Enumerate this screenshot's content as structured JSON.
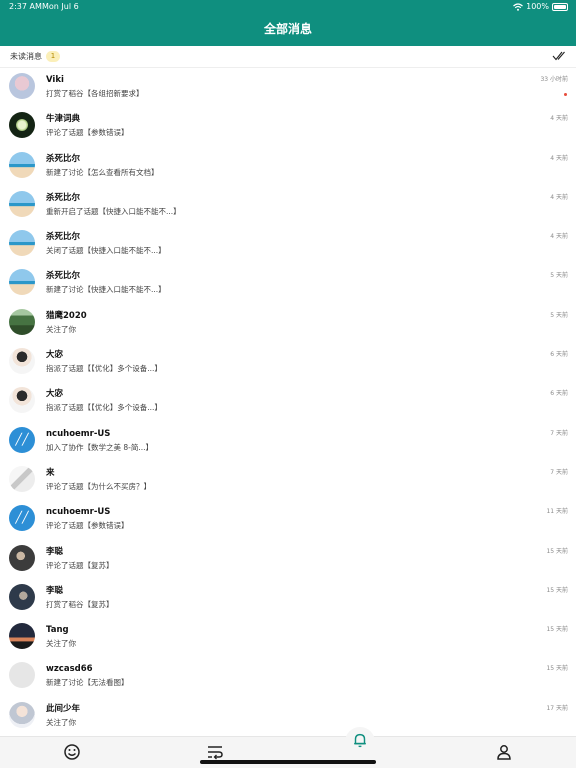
{
  "status_bar": {
    "time": "2:37 AM",
    "date": "Mon Jul 6",
    "battery": "100%"
  },
  "header": {
    "title": "全部消息"
  },
  "filter": {
    "label": "未读消息",
    "unread_count": "1"
  },
  "notifications": [
    {
      "name": "Viki",
      "action": "打赏了稻谷【各组招新要求】",
      "time": "33 小时前",
      "avatar": "av-anime",
      "unread": true
    },
    {
      "name": "牛津词典",
      "action": "评论了话题【参数错误】",
      "time": "4 天前",
      "avatar": "av-flower",
      "unread": false
    },
    {
      "name": "杀死比尔",
      "action": "新建了讨论【怎么查看所有文档】",
      "time": "4 天前",
      "avatar": "av-beach",
      "unread": false
    },
    {
      "name": "杀死比尔",
      "action": "重新开启了话题【快捷入口能不能不...】",
      "time": "4 天前",
      "avatar": "av-beach",
      "unread": false
    },
    {
      "name": "杀死比尔",
      "action": "关闭了话题【快捷入口能不能不...】",
      "time": "4 天前",
      "avatar": "av-beach",
      "unread": false
    },
    {
      "name": "杀死比尔",
      "action": "新建了讨论【快捷入口能不能不...】",
      "time": "5 天前",
      "avatar": "av-beach",
      "unread": false
    },
    {
      "name": "猎鹰2020",
      "action": "关注了你",
      "time": "5 天前",
      "avatar": "av-forest",
      "unread": false
    },
    {
      "name": "大宓",
      "action": "指派了话题【【优化】多个设备...】",
      "time": "6 天前",
      "avatar": "av-person",
      "unread": false
    },
    {
      "name": "大宓",
      "action": "指派了话题【【优化】多个设备...】",
      "time": "6 天前",
      "avatar": "av-person",
      "unread": false
    },
    {
      "name": "ncuhoemr-US",
      "action": "加入了协作【数学之美 8-简...】",
      "time": "7 天前",
      "avatar": "av-logo",
      "unread": false
    },
    {
      "name": "来",
      "action": "评论了话题【为什么不买房？】",
      "time": "7 天前",
      "avatar": "av-silhouette",
      "unread": false
    },
    {
      "name": "ncuhoemr-US",
      "action": "评论了话题【参数错误】",
      "time": "11 天前",
      "avatar": "av-logo",
      "unread": false
    },
    {
      "name": "李聪",
      "action": "评论了话题【复苏】",
      "time": "15 天前",
      "avatar": "av-dark",
      "unread": false
    },
    {
      "name": "李聪",
      "action": "打赏了稻谷【复苏】",
      "time": "15 天前",
      "avatar": "av-dark2",
      "unread": false
    },
    {
      "name": "Tang",
      "action": "关注了你",
      "time": "15 天前",
      "avatar": "av-sunset",
      "unread": false
    },
    {
      "name": "wzcasd66",
      "action": "新建了讨论【无法看图】",
      "time": "15 天前",
      "avatar": "av-blank",
      "unread": false
    },
    {
      "name": "此间少年",
      "action": "关注了你",
      "time": "17 天前",
      "avatar": "av-girl",
      "unread": false
    }
  ],
  "colors": {
    "brand": "#0f8f7f",
    "unread": "#e74c3c",
    "pill": "#fbefb9"
  },
  "tabs": [
    {
      "name": "tab-home",
      "icon": "smile-icon",
      "active": false
    },
    {
      "name": "tab-feed",
      "icon": "wrap-icon",
      "active": false
    },
    {
      "name": "tab-notifications",
      "icon": "bell-icon",
      "active": true
    },
    {
      "name": "tab-profile",
      "icon": "person-icon",
      "active": false
    }
  ]
}
